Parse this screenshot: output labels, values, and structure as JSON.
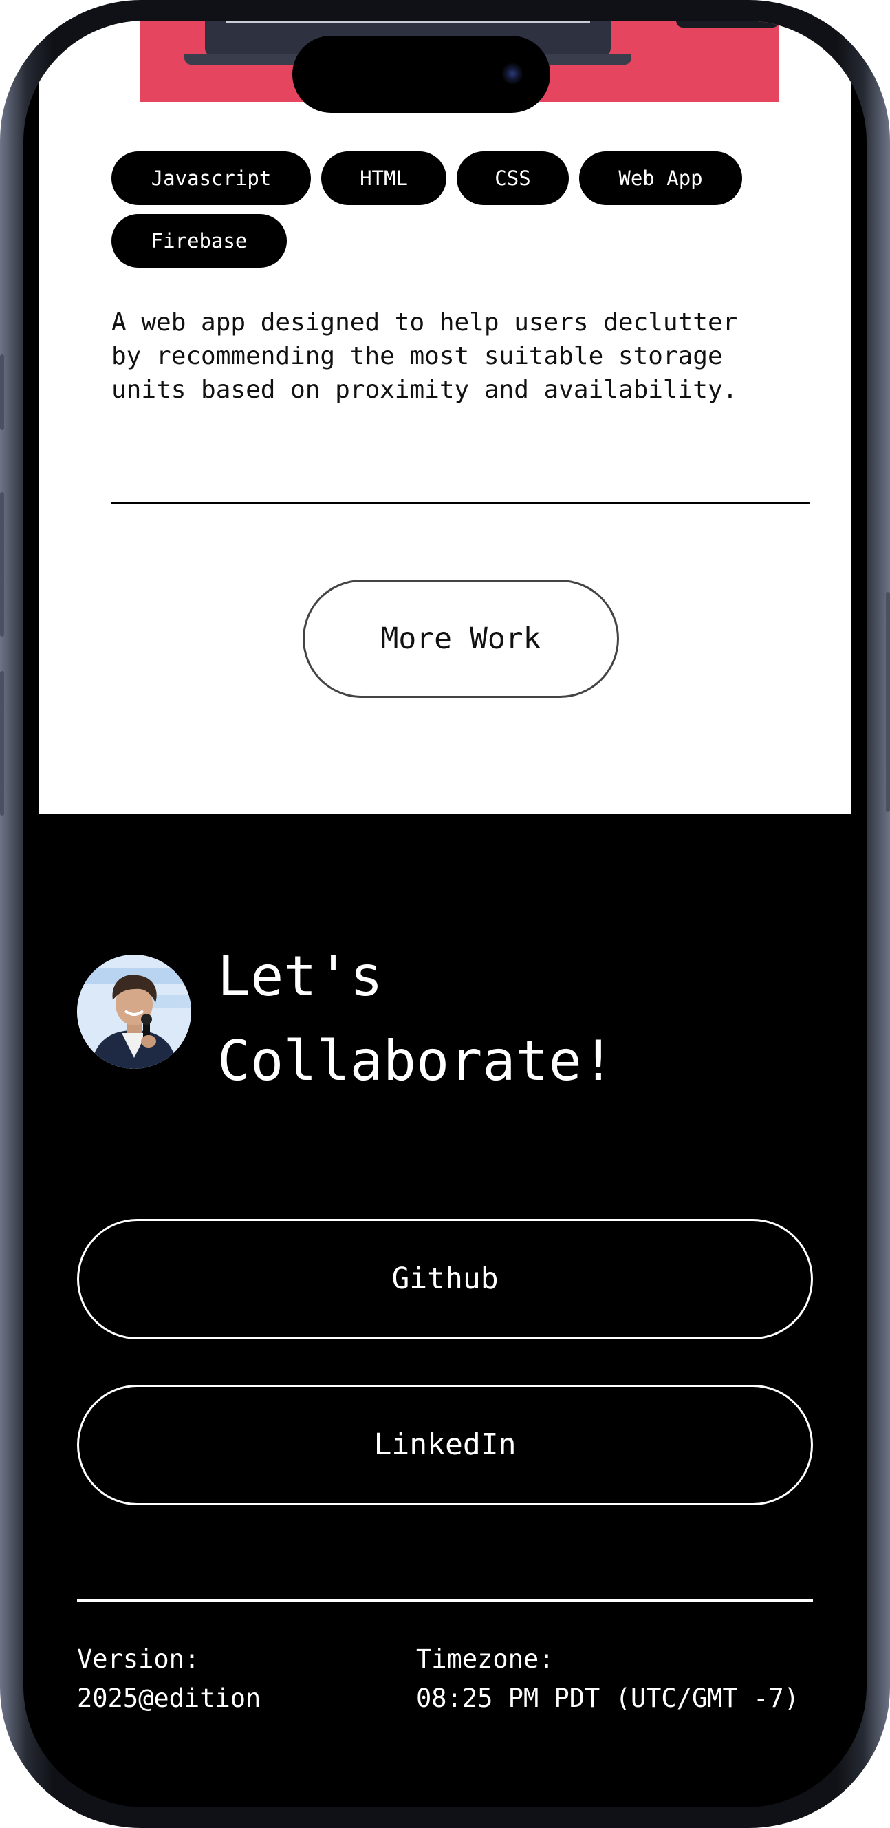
{
  "project": {
    "tags": [
      "Javascript",
      "HTML",
      "CSS",
      "Web App",
      "Firebase"
    ],
    "description": "A web app designed to help users declutter\nby recommending the most suitable storage\nunits based on proximity and availability."
  },
  "actions": {
    "more_work_label": "More Work"
  },
  "collaborate": {
    "title_line1": "Let's",
    "title_line2": "Collaborate!",
    "links": [
      {
        "label": "Github"
      },
      {
        "label": "LinkedIn"
      }
    ]
  },
  "footer": {
    "version_label": "Version:",
    "version_value": "2025@edition",
    "timezone_label": "Timezone:",
    "timezone_value": "08:25 PM PDT (UTC/GMT -7)"
  },
  "colors": {
    "hero_accent": "#e6455f",
    "page_dark": "#000000",
    "page_light": "#ffffff"
  },
  "icons": {
    "avatar": "profile-photo"
  }
}
